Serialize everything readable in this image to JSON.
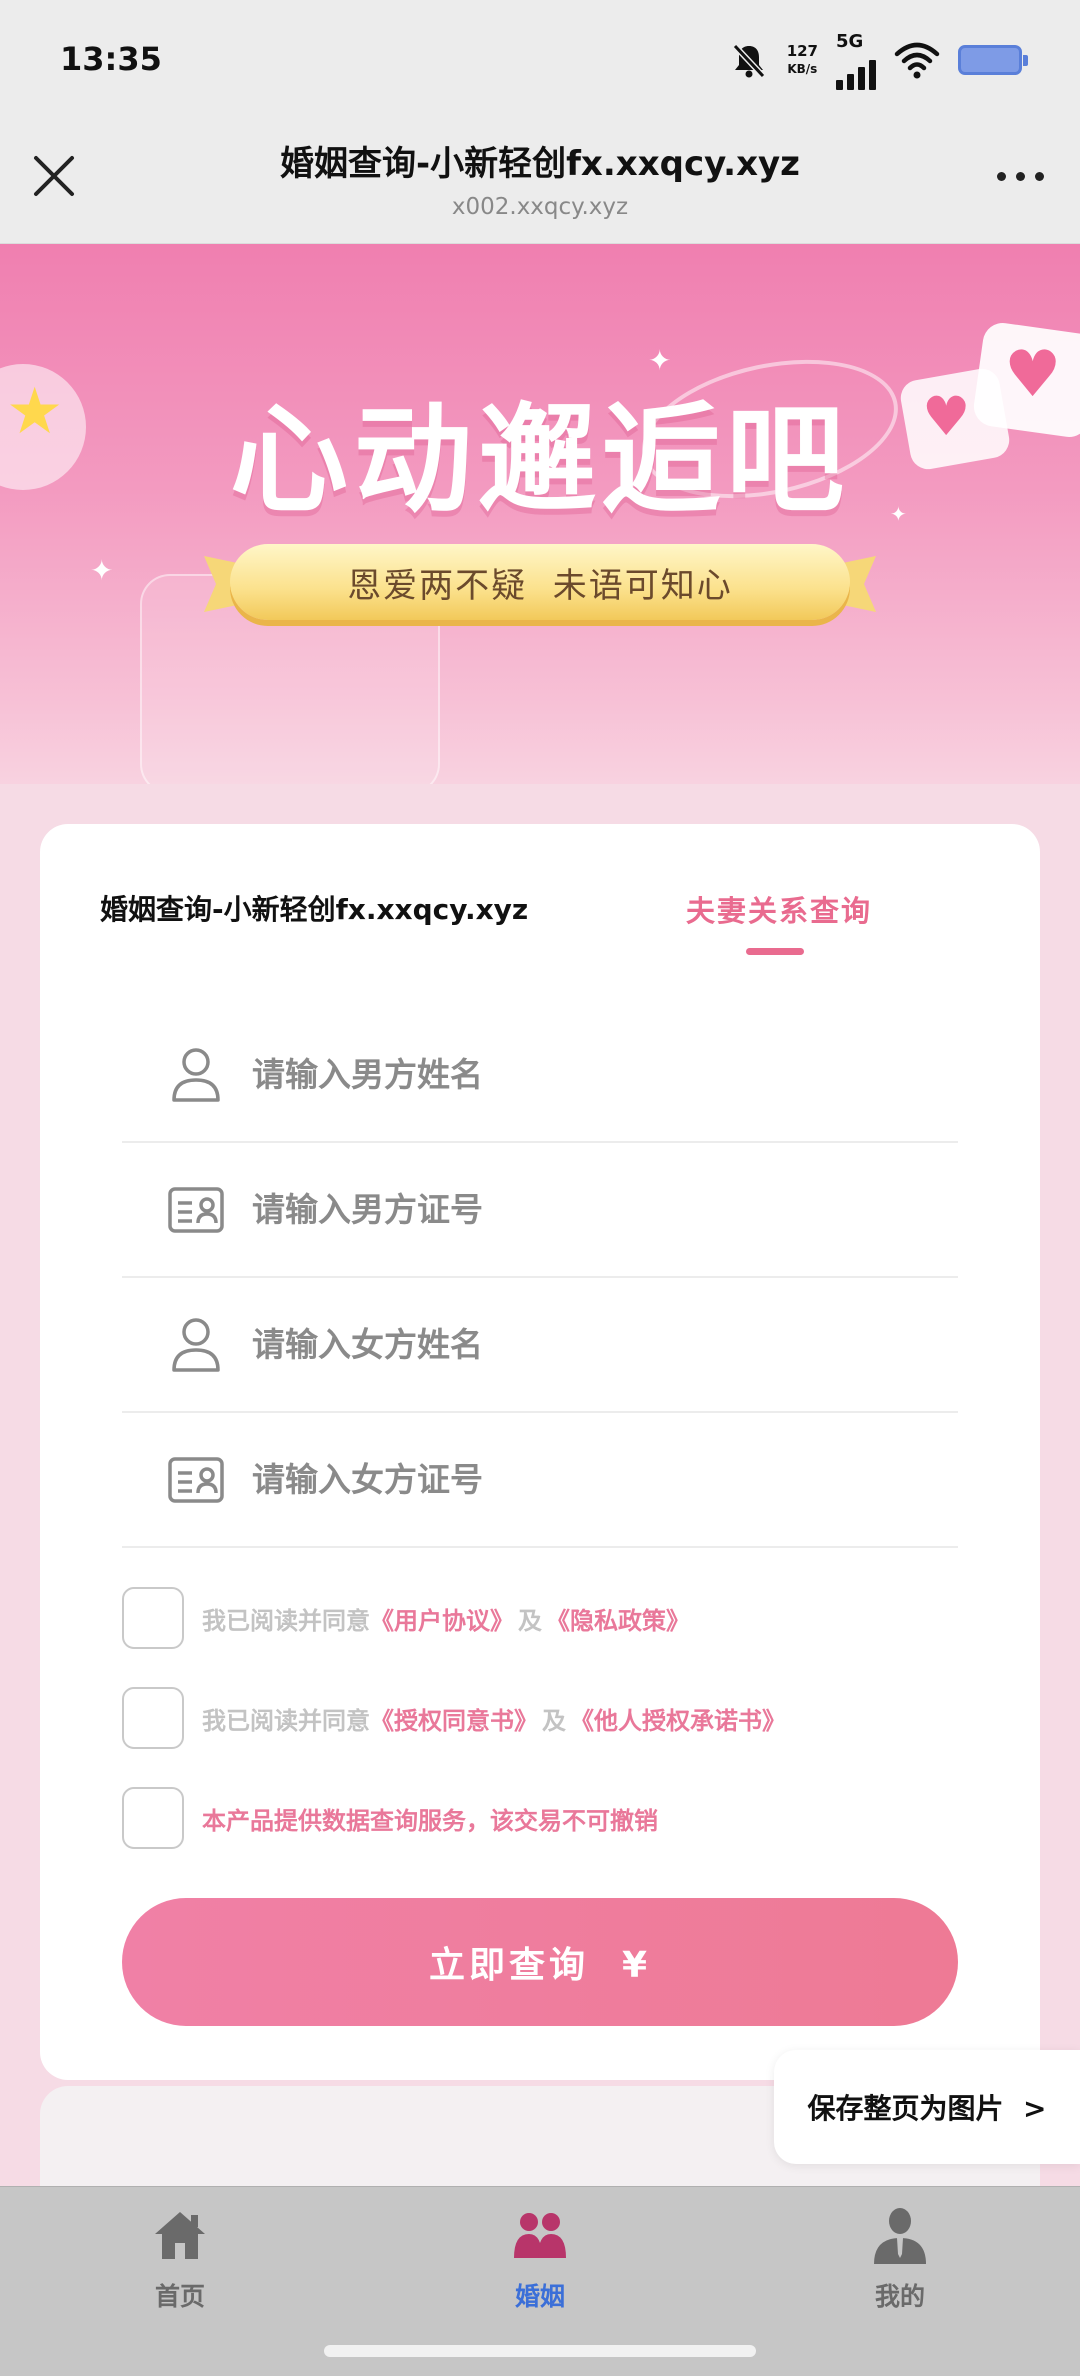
{
  "status_bar": {
    "time": "13:35",
    "net_speed_value": "127",
    "net_speed_unit": "KB/s",
    "network": "5G"
  },
  "title_bar": {
    "title": "婚姻查询-小新轻创fx.xxqcy.xyz",
    "url": "x002.xxqcy.xyz"
  },
  "banner": {
    "headline": "心动邂逅吧",
    "tagline": "恩爱两不疑  未语可知心"
  },
  "form": {
    "tab_left": "婚姻查询-小新轻创fx.xxqcy.xyz",
    "tab_right": "夫妻关系查询",
    "fields": [
      {
        "placeholder": "请输入男方姓名",
        "value": ""
      },
      {
        "placeholder": "请输入男方证号",
        "value": ""
      },
      {
        "placeholder": "请输入女方姓名",
        "value": ""
      },
      {
        "placeholder": "请输入女方证号",
        "value": ""
      }
    ],
    "agreements": [
      {
        "prefix": "我已阅读并同意",
        "link1": "《用户协议》",
        "joiner": "及",
        "link2": "《隐私政策》",
        "checked": false
      },
      {
        "prefix": "我已阅读并同意",
        "link1": "《授权同意书》",
        "joiner": "及",
        "link2": "《他人授权承诺书》",
        "checked": false
      }
    ],
    "notice": {
      "text": "本产品提供数据查询服务，该交易不可撤销",
      "checked": false
    },
    "submit_label": "立即查询  ¥"
  },
  "save_button": "保存整页为图片  >",
  "bottom_nav": {
    "items": [
      {
        "label": "首页",
        "icon": "home-icon",
        "active": false
      },
      {
        "label": "婚姻",
        "icon": "couple-icon",
        "active": true
      },
      {
        "label": "我的",
        "icon": "person-icon",
        "active": false
      }
    ]
  },
  "colors": {
    "accent": "#e96b8f",
    "nav_active": "#3b6fd8",
    "banner_pink": "#f07fb0"
  }
}
